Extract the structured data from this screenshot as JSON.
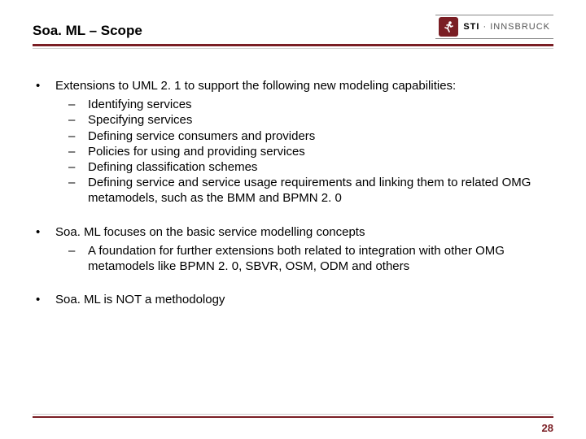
{
  "header": {
    "title": "Soa. ML – Scope",
    "logo_text_bold": "STI",
    "logo_text_rest": " · INNSBRUCK"
  },
  "content": {
    "b1": {
      "text": "Extensions to UML 2. 1 to support the following new modeling capabilities:",
      "subs": [
        "Identifying services",
        "Specifying services",
        "Defining service consumers and providers",
        "Policies for using and providing services",
        "Defining classification schemes",
        "Defining service and service usage requirements and linking them to related OMG metamodels, such as the BMM and BPMN 2. 0"
      ]
    },
    "b2": {
      "text": "Soa. ML focuses on the basic service modelling concepts",
      "subs": [
        "A foundation for further extensions both related to integration with other OMG metamodels like BPMN 2. 0, SBVR, OSM, ODM and others"
      ]
    },
    "b3": {
      "text": "Soa. ML is NOT a methodology"
    }
  },
  "page_number": "28"
}
